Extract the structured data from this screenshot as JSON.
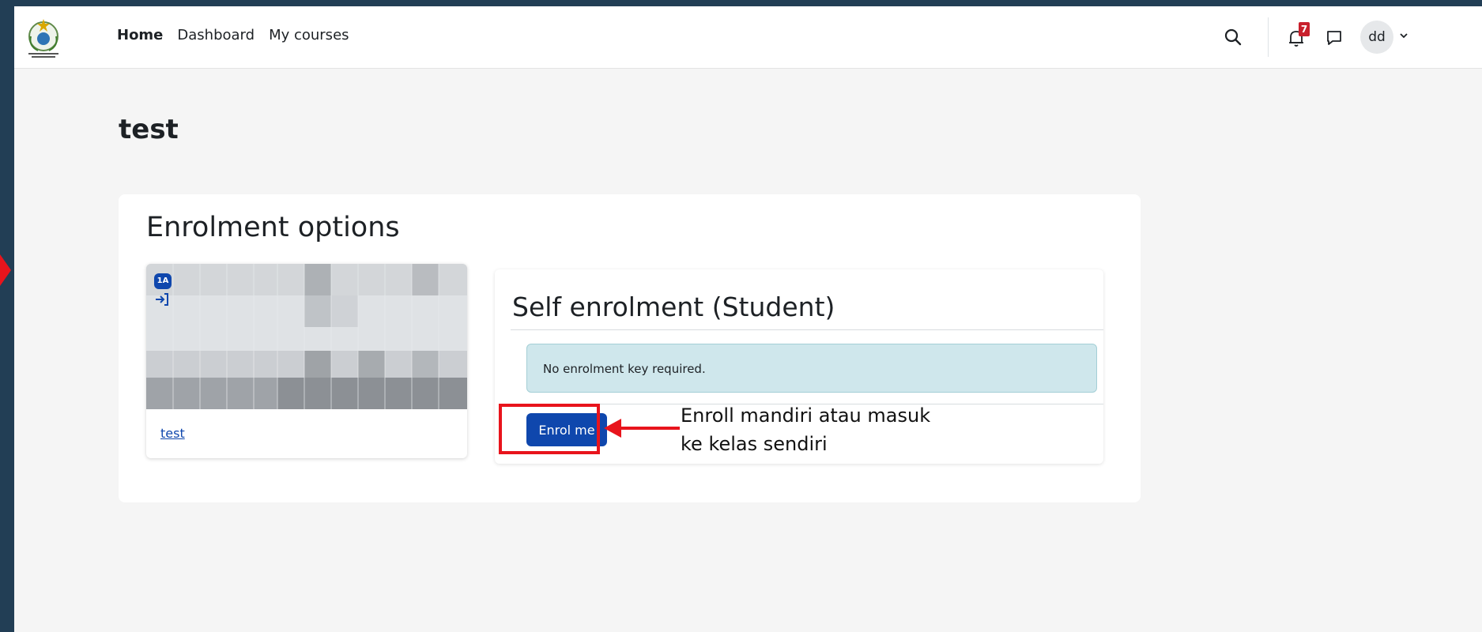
{
  "nav": {
    "links": [
      "Home",
      "Dashboard",
      "My courses"
    ],
    "notification_count": "7",
    "avatar_initials": "dd"
  },
  "page": {
    "title": "test"
  },
  "enrolment": {
    "heading": "Enrolment options",
    "course": {
      "badge": "1A",
      "name": "test"
    },
    "method": {
      "title": "Self enrolment (Student)",
      "info": "No enrolment key required.",
      "button_label": "Enrol me"
    }
  },
  "annotation": {
    "line1": "Enroll mandiri atau masuk",
    "line2": "ke kelas sendiri",
    "color": "#e8141c"
  },
  "colors": {
    "frame": "#223e55",
    "primary": "#0f47ad",
    "badge_red": "#c8202c",
    "info_bg": "#cfe7ec",
    "accent_orange": "#e4762a"
  }
}
